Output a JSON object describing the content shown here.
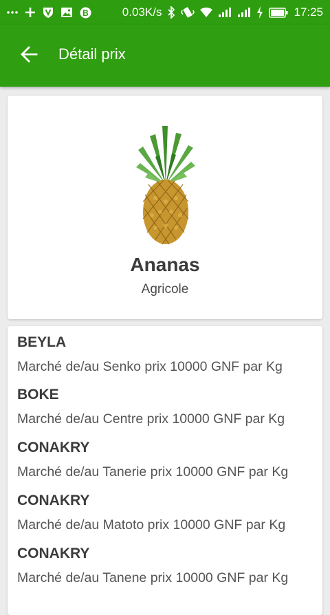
{
  "status_bar": {
    "left_icons": [
      "more-dots-icon",
      "plus-icon",
      "shield-v-icon",
      "image-icon",
      "bitcoin-icon"
    ],
    "network_speed": "0.03K/s",
    "right_icons": [
      "bluetooth-icon",
      "vibrate-icon",
      "wifi-icon",
      "signal-icon",
      "signal-icon",
      "charging-icon",
      "battery-icon"
    ],
    "time": "17:25"
  },
  "app_bar": {
    "back_icon": "arrow-back-icon",
    "title": "Détail prix"
  },
  "product": {
    "image_icon": "pineapple-image",
    "name": "Ananas",
    "category": "Agricole"
  },
  "prices": [
    {
      "region": "BEYLA",
      "detail": "Marché de/au Senko prix 10000 GNF par Kg"
    },
    {
      "region": "BOKE",
      "detail": "Marché de/au Centre prix 10000 GNF par Kg"
    },
    {
      "region": "CONAKRY",
      "detail": "Marché de/au Tanerie prix 10000 GNF par Kg"
    },
    {
      "region": "CONAKRY",
      "detail": "Marché de/au Matoto prix 10000 GNF par Kg"
    },
    {
      "region": "CONAKRY",
      "detail": "Marché de/au Tanene prix 10000 GNF par Kg"
    }
  ],
  "colors": {
    "status_bar": "#2e9d0f",
    "app_bar": "#2f9e10",
    "background": "#ececec"
  }
}
